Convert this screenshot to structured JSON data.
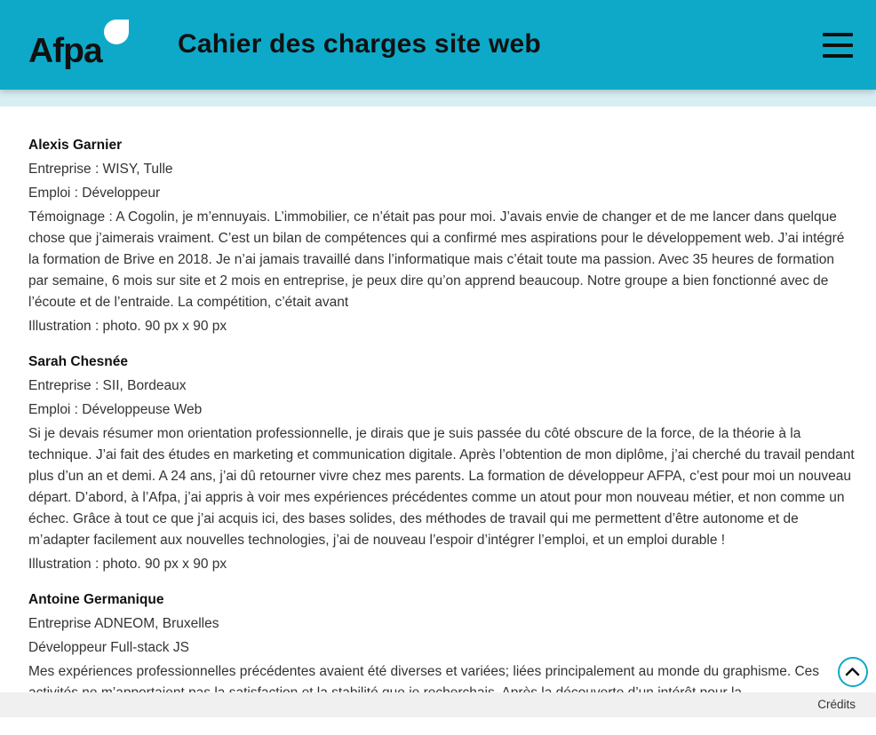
{
  "header": {
    "logo_text": "Afpa",
    "title": "Cahier des charges site web",
    "menu_icon": "hamburger-menu-icon",
    "background_color": "#0ea9c8"
  },
  "testimonials": [
    {
      "name": "Alexis Garnier",
      "company": "Entreprise : WISY, Tulle",
      "job": "Emploi : Développeur",
      "text": "Témoignage : A Cogolin, je m’ennuyais. L’immobilier, ce n’était pas pour moi. J’avais envie de changer et de me lancer dans quelque chose que j’aimerais vraiment. C’est un bilan de compétences qui a confirmé mes aspirations pour le développement web. J’ai intégré la formation de Brive en 2018. Je n’ai jamais travaillé dans l’informatique mais c’était toute ma passion. Avec 35 heures de formation par semaine, 6 mois sur site et 2 mois en entreprise, je peux dire qu’on apprend beaucoup. Notre groupe a bien fonctionné avec de l’écoute et de l’entraide. La compétition, c’était avant",
      "illustration": "Illustration : photo. 90 px x 90 px"
    },
    {
      "name": "Sarah Chesnée",
      "company": "Entreprise : SII, Bordeaux",
      "job": "Emploi : Développeuse Web",
      "text": "Si je devais résumer mon orientation professionnelle, je dirais que je suis passée du côté obscure de la force, de la théorie à la technique. J’ai fait des études en marketing et communication digitale. Après l’obtention de mon diplôme, j’ai cherché du travail pendant plus d’un an et demi. A 24 ans, j’ai dû retourner vivre chez mes parents. La formation de développeur AFPA, c’est pour moi un nouveau départ. D’abord, à l’Afpa, j’ai appris à voir mes expériences précédentes comme un atout pour mon nouveau métier, et non comme un échec. Grâce à tout ce que j’ai acquis ici, des bases solides, des méthodes de travail qui me permettent d’être autonome et de m’adapter facilement aux nouvelles technologies, j’ai de nouveau l’espoir d’intégrer l’emploi, et un emploi durable !",
      "illustration": "Illustration : photo. 90 px x 90 px"
    },
    {
      "name": "Antoine Germanique",
      "company": "Entreprise ADNEOM, Bruxelles",
      "job": "Développeur Full-stack JS",
      "text": "Mes expériences professionnelles précédentes avaient été diverses et variées; liées principalement au monde du graphisme. Ces activités ne m’apportaient pas la satisfaction et la stabilité que je recherchais. Après la découverte d’un intérêt pour la",
      "illustration": ""
    }
  ],
  "footer": {
    "credits_label": "Crédits"
  },
  "scroll_top_icon": "chevron-up-icon"
}
